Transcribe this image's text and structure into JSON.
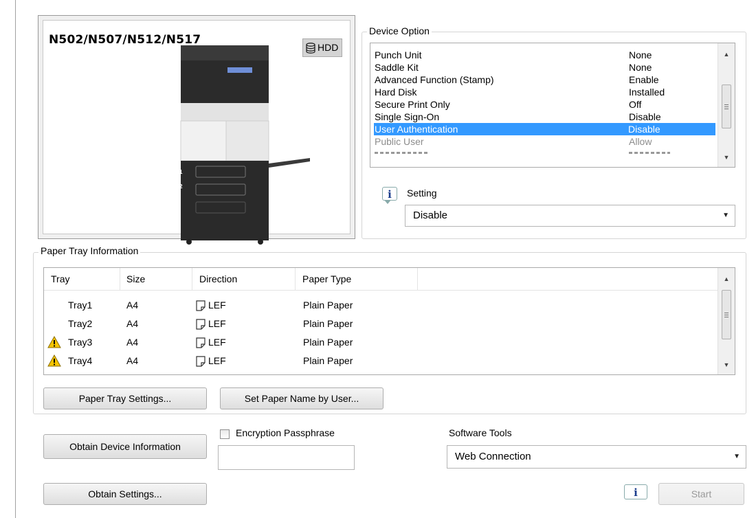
{
  "preview": {
    "model": "N502/N507/N512/N517",
    "hdd_label": "HDD",
    "tray_numbers": [
      "1",
      "2"
    ]
  },
  "device_option": {
    "title": "Device Option",
    "items": [
      {
        "name": "Punch Unit",
        "value": "None"
      },
      {
        "name": "Saddle Kit",
        "value": "None"
      },
      {
        "name": "Advanced Function (Stamp)",
        "value": "Enable"
      },
      {
        "name": "Hard Disk",
        "value": "Installed"
      },
      {
        "name": "Secure Print Only",
        "value": "Off"
      },
      {
        "name": "Single Sign-On",
        "value": "Disable"
      },
      {
        "name": "User Authentication",
        "value": "Disable"
      },
      {
        "name": "Public User",
        "value": "Allow"
      }
    ],
    "selected_index": 6,
    "setting_label": "Setting",
    "setting_value": "Disable"
  },
  "paper_tray": {
    "title": "Paper Tray Information",
    "columns": [
      "Tray",
      "Size",
      "Direction",
      "Paper Type"
    ],
    "rows": [
      {
        "tray": "Tray1",
        "size": "A4",
        "direction": "LEF",
        "type": "Plain Paper",
        "warning": false
      },
      {
        "tray": "Tray2",
        "size": "A4",
        "direction": "LEF",
        "type": "Plain Paper",
        "warning": false
      },
      {
        "tray": "Tray3",
        "size": "A4",
        "direction": "LEF",
        "type": "Plain Paper",
        "warning": true
      },
      {
        "tray": "Tray4",
        "size": "A4",
        "direction": "LEF",
        "type": "Plain Paper",
        "warning": true
      }
    ],
    "paper_tray_settings_button": "Paper Tray Settings...",
    "set_paper_name_button": "Set Paper Name by User..."
  },
  "bottom": {
    "obtain_device_info_button": "Obtain Device Information",
    "encryption_label": "Encryption Passphrase",
    "encryption_checked": false,
    "passphrase_value": "",
    "software_tools_label": "Software Tools",
    "software_tools_value": "Web Connection",
    "obtain_settings_button": "Obtain Settings...",
    "start_button": "Start"
  },
  "colors": {
    "selection": "#3399ff",
    "warning": "#f5c400"
  }
}
